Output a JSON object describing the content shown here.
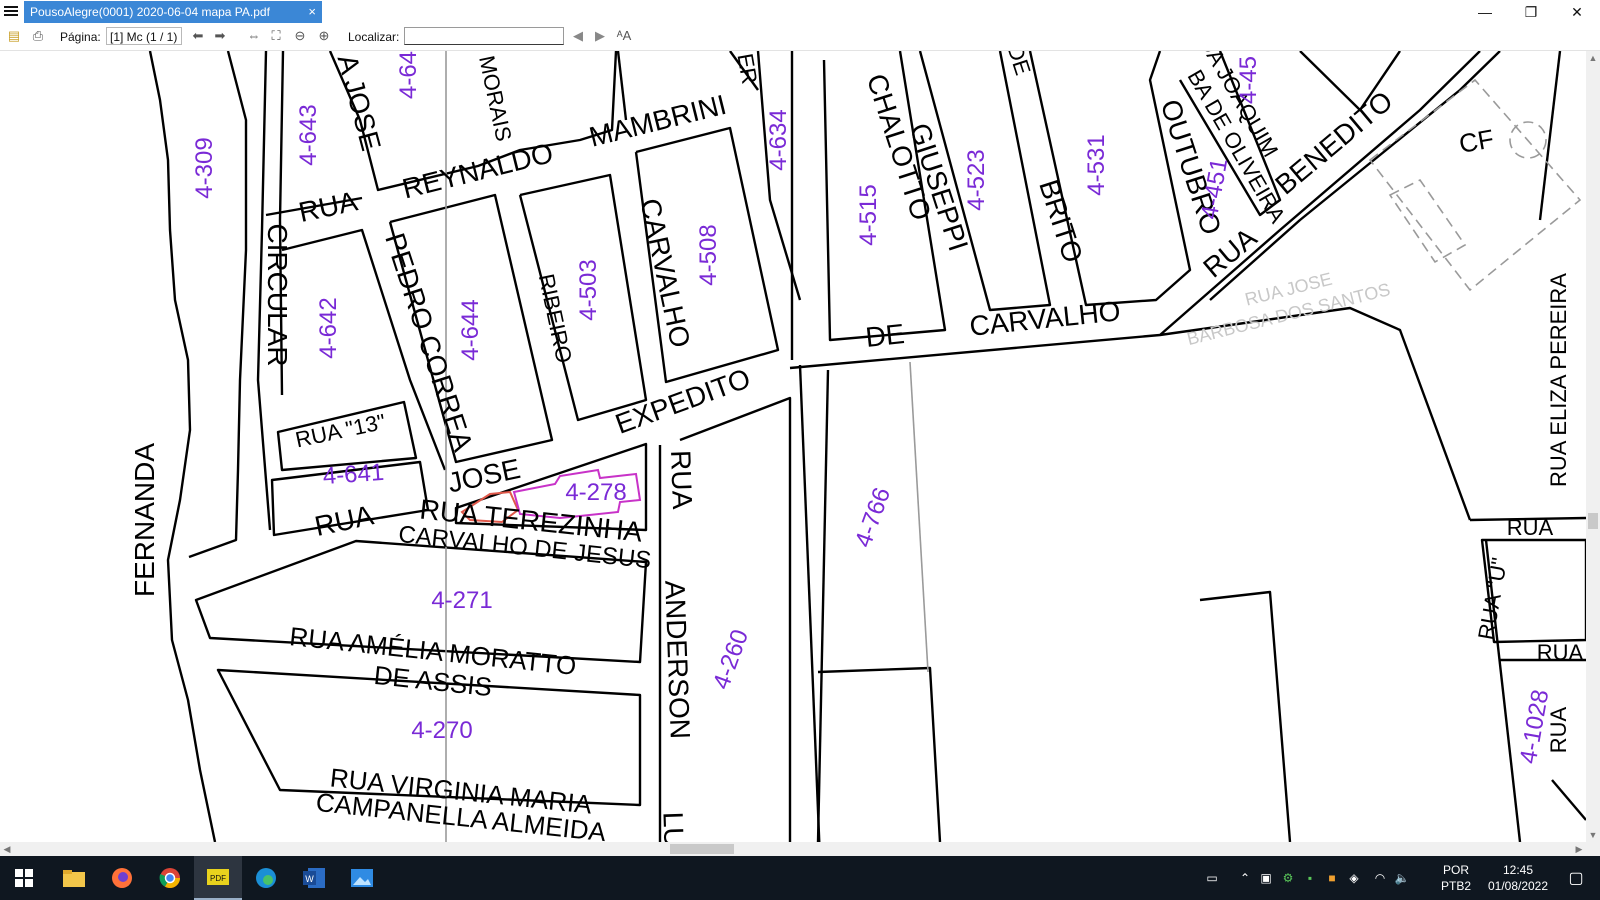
{
  "window": {
    "tab_title": "PousoAlegre(0001) 2020-06-04 mapa PA.pdf",
    "tab_close": "×",
    "minimize": "—",
    "restore": "❐",
    "close": "✕"
  },
  "toolbar": {
    "page_label": "Página:",
    "page_value": "[1] Mc (1 / 1)",
    "find_label": "Localizar:",
    "find_value": "",
    "prev_arrow": "◀",
    "next_arrow": "▶",
    "font_icon": "ᴬA"
  },
  "map": {
    "colors": {
      "lot": "#8a2be2",
      "lines": "#000000",
      "highlight": "#e0584a",
      "faint": "#b0b0b0"
    },
    "streets": [
      "FERNANDA",
      "CIRCULAR",
      "RUA",
      "A JOSE",
      "PEDRO CORREA",
      "RUA \"13\"",
      "JOSE",
      "RUA",
      "RUA TEREZINHA",
      "CARVALHO DE JESUS",
      "REYNALDO",
      "MAMBRINI",
      "MORAIS",
      "RIBEIRO",
      "CARVALHO",
      "EXPEDITO",
      "RUA",
      "ANDERSON",
      "LU",
      "RUA AMÉLIA MORATTO",
      "DE ASSIS",
      "RUA VIRGINIA MARIA",
      "CAMPANELLA ALMEIDA",
      "ER",
      "CHALOTTO",
      "GIUSEPPI",
      "DE",
      "BRITO",
      "OUTUBRO",
      "BA DE OLIVEIRA",
      "DA JOAQUIM",
      "RUA",
      "BENEDITO",
      "DE",
      "CARVALHO",
      "RUA ELIZA PEREIRA",
      "RUA",
      "RUA \"U\"",
      "RUA",
      "RUA",
      "CF"
    ],
    "faint_text": [
      "RUA JOSE",
      "BARBOSA DOS SANTOS"
    ],
    "lots": [
      "4-309",
      "4-643",
      "4-64",
      "4-642",
      "4-644",
      "4-503",
      "4-508",
      "4-634",
      "4-515",
      "4-523",
      "4-531",
      "4-451",
      "4-45",
      "4-641",
      "4-278",
      "4-271",
      "4-270",
      "4-260",
      "4-766",
      "4-1028"
    ]
  },
  "taskbar": {
    "lang_line1": "POR",
    "lang_line2": "PTB2",
    "time": "12:45",
    "date": "01/08/2022"
  }
}
